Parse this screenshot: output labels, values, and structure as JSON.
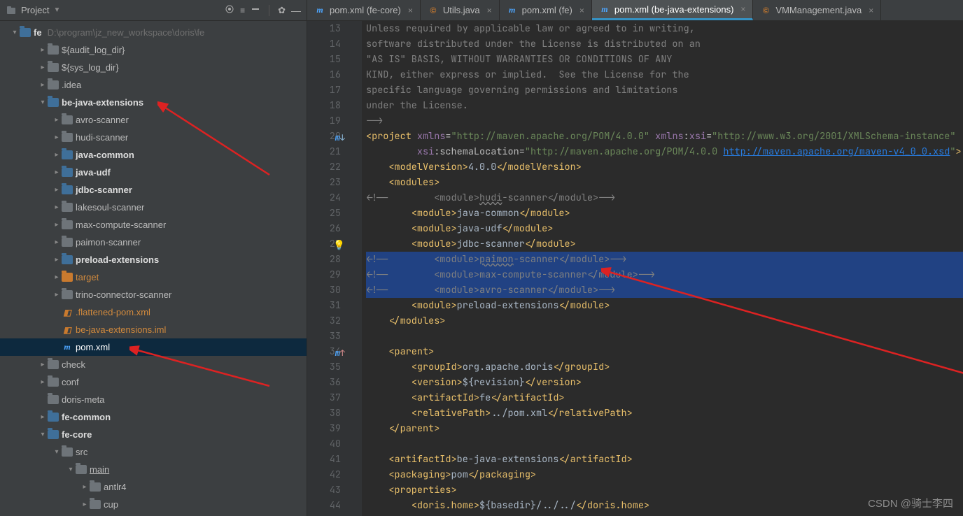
{
  "sidebar": {
    "title": "Project",
    "root": {
      "name": "fe",
      "path": "D:\\program\\jz_new_workspace\\doris\\fe"
    },
    "items": [
      {
        "name": "${audit_log_dir}",
        "indent": 2,
        "arrow": ">",
        "kind": "folder"
      },
      {
        "name": "${sys_log_dir}",
        "indent": 2,
        "arrow": ">",
        "kind": "folder"
      },
      {
        "name": ".idea",
        "indent": 2,
        "arrow": ">",
        "kind": "folder"
      },
      {
        "name": "be-java-extensions",
        "indent": 2,
        "arrow": "v",
        "kind": "mod",
        "bold": true
      },
      {
        "name": "avro-scanner",
        "indent": 3,
        "arrow": ">",
        "kind": "folder"
      },
      {
        "name": "hudi-scanner",
        "indent": 3,
        "arrow": ">",
        "kind": "folder"
      },
      {
        "name": "java-common",
        "indent": 3,
        "arrow": ">",
        "kind": "mod",
        "bold": true
      },
      {
        "name": "java-udf",
        "indent": 3,
        "arrow": ">",
        "kind": "mod",
        "bold": true
      },
      {
        "name": "jdbc-scanner",
        "indent": 3,
        "arrow": ">",
        "kind": "mod",
        "bold": true
      },
      {
        "name": "lakesoul-scanner",
        "indent": 3,
        "arrow": ">",
        "kind": "folder"
      },
      {
        "name": "max-compute-scanner",
        "indent": 3,
        "arrow": ">",
        "kind": "folder"
      },
      {
        "name": "paimon-scanner",
        "indent": 3,
        "arrow": ">",
        "kind": "folder"
      },
      {
        "name": "preload-extensions",
        "indent": 3,
        "arrow": ">",
        "kind": "mod",
        "bold": true
      },
      {
        "name": "target",
        "indent": 3,
        "arrow": ">",
        "kind": "orange",
        "highlight": true
      },
      {
        "name": "trino-connector-scanner",
        "indent": 3,
        "arrow": ">",
        "kind": "folder"
      },
      {
        "name": ".flattened-pom.xml",
        "indent": 3,
        "arrow": "",
        "kind": "file-xml",
        "highlight": true
      },
      {
        "name": "be-java-extensions.iml",
        "indent": 3,
        "arrow": "",
        "kind": "file-iml",
        "highlight": true
      },
      {
        "name": "pom.xml",
        "indent": 3,
        "arrow": "",
        "kind": "file-m",
        "selected": true
      },
      {
        "name": "check",
        "indent": 2,
        "arrow": ">",
        "kind": "folder"
      },
      {
        "name": "conf",
        "indent": 2,
        "arrow": ">",
        "kind": "folder"
      },
      {
        "name": "doris-meta",
        "indent": 2,
        "arrow": "",
        "kind": "folder"
      },
      {
        "name": "fe-common",
        "indent": 2,
        "arrow": ">",
        "kind": "mod",
        "bold": true
      },
      {
        "name": "fe-core",
        "indent": 2,
        "arrow": "v",
        "kind": "mod",
        "bold": true
      },
      {
        "name": "src",
        "indent": 3,
        "arrow": "v",
        "kind": "folder"
      },
      {
        "name": "main",
        "indent": 4,
        "arrow": "v",
        "kind": "folder",
        "underline": true
      },
      {
        "name": "antlr4",
        "indent": 5,
        "arrow": ">",
        "kind": "folder"
      },
      {
        "name": "cup",
        "indent": 5,
        "arrow": ">",
        "kind": "folder"
      }
    ]
  },
  "tabs": [
    {
      "icon": "m",
      "label": "pom.xml (fe-core)"
    },
    {
      "icon": "c",
      "label": "Utils.java"
    },
    {
      "icon": "m",
      "label": "pom.xml (fe)"
    },
    {
      "icon": "m",
      "label": "pom.xml (be-java-extensions)",
      "active": true
    },
    {
      "icon": "c",
      "label": "VMManagement.java"
    }
  ],
  "code": {
    "first_line": 13,
    "lines": [
      {
        "n": 13,
        "html": "<span class='c-comment'>Unless required by applicable law or agreed to in writing,</span>"
      },
      {
        "n": 14,
        "html": "<span class='c-comment'>software distributed under the License is distributed on an</span>"
      },
      {
        "n": 15,
        "html": "<span class='c-comment'>\"AS IS\" BASIS, WITHOUT WARRANTIES OR CONDITIONS OF ANY</span>"
      },
      {
        "n": 16,
        "html": "<span class='c-comment'>KIND, either express or implied.  See the License for the</span>"
      },
      {
        "n": 17,
        "html": "<span class='c-comment'>specific language governing permissions and limitations</span>"
      },
      {
        "n": 18,
        "html": "<span class='c-comment'>under the License.</span>"
      },
      {
        "n": 19,
        "html": "<span class='c-comment'>--&gt;</span>"
      },
      {
        "n": 20,
        "gut": "m↓",
        "html": "<span class='c-tag'>&lt;project</span> <span class='c-ns'>xmlns</span><span class='c-attr'>=</span><span class='c-str'>\"http://maven.apache.org/POM/4.0.0\"</span> <span class='c-ns'>xmlns</span><span class='c-attr'>:</span><span class='c-ns'>xsi</span><span class='c-attr'>=</span><span class='c-str'>\"http://www.w3.org/2001/XMLSchema-instance\"</span>"
      },
      {
        "n": 21,
        "html": "         <span class='c-ns'>xsi</span><span class='c-attr'>:</span><span class='c-attr'>schemaLocation</span><span class='c-attr'>=</span><span class='c-str'>\"http://maven.apache.org/POM/4.0.0 </span><span class='c-link'>http://maven.apache.org/maven-v4_0_0.xsd</span><span class='c-str'>\"</span><span class='c-tag'>&gt;</span>"
      },
      {
        "n": 22,
        "html": "    <span class='c-tag'>&lt;modelVersion&gt;</span><span class='c-text'>4.0.0</span><span class='c-tag'>&lt;/modelVersion&gt;</span>"
      },
      {
        "n": 23,
        "html": "    <span class='c-tag'>&lt;modules&gt;</span>"
      },
      {
        "n": 24,
        "html": "<span class='c-comment'>&lt;!--        &lt;module&gt;<span class='c-underline'>hudi</span>-scanner&lt;/module&gt;--&gt;</span>"
      },
      {
        "n": 25,
        "html": "        <span class='c-tag'>&lt;module&gt;</span><span class='c-text'>java-common</span><span class='c-tag'>&lt;/module&gt;</span>"
      },
      {
        "n": 26,
        "html": "        <span class='c-tag'>&lt;module&gt;</span><span class='c-text'>java-udf</span><span class='c-tag'>&lt;/module&gt;</span>"
      },
      {
        "n": 27,
        "gut": "bulb",
        "html": "        <span class='c-tag'>&lt;module&gt;</span><span class='c-text'>jdbc-scanner</span><span class='c-tag'>&lt;/module&gt;</span>"
      },
      {
        "n": 28,
        "sel": true,
        "html": "<span class='c-comment'>&lt;!--        &lt;module&gt;<span class='c-underline'>paimon</span>-scanner&lt;/module&gt;--&gt;</span>"
      },
      {
        "n": 29,
        "sel": true,
        "html": "<span class='c-comment'>&lt;!--        &lt;module&gt;max-compute-scanner&lt;/module&gt;--&gt;</span>"
      },
      {
        "n": 30,
        "sel": true,
        "html": "<span class='c-comment'>&lt;!--        &lt;module&gt;avro-scanner&lt;/module&gt;--&gt;</span>"
      },
      {
        "n": 31,
        "html": "        <span class='c-tag'>&lt;module&gt;</span><span class='c-text'>preload-extensions</span><span class='c-tag'>&lt;/module&gt;</span>"
      },
      {
        "n": 32,
        "html": "    <span class='c-tag'>&lt;/modules&gt;</span>"
      },
      {
        "n": 33,
        "html": ""
      },
      {
        "n": 34,
        "gut": "m↑",
        "html": "    <span class='c-tag'>&lt;parent&gt;</span>"
      },
      {
        "n": 35,
        "html": "        <span class='c-tag'>&lt;groupId&gt;</span><span class='c-text'>org.apache.doris</span><span class='c-tag'>&lt;/groupId&gt;</span>"
      },
      {
        "n": 36,
        "html": "        <span class='c-tag'>&lt;version&gt;</span><span class='c-text'>${revision}</span><span class='c-tag'>&lt;/version&gt;</span>"
      },
      {
        "n": 37,
        "html": "        <span class='c-tag'>&lt;artifactId&gt;</span><span class='c-text'>fe</span><span class='c-tag'>&lt;/artifactId&gt;</span>"
      },
      {
        "n": 38,
        "html": "        <span class='c-tag'>&lt;relativePath&gt;</span><span class='c-text'>../pom.xml</span><span class='c-tag'>&lt;/relativePath&gt;</span>"
      },
      {
        "n": 39,
        "html": "    <span class='c-tag'>&lt;/parent&gt;</span>"
      },
      {
        "n": 40,
        "html": ""
      },
      {
        "n": 41,
        "html": "    <span class='c-tag'>&lt;artifactId&gt;</span><span class='c-text'>be-java-extensions</span><span class='c-tag'>&lt;/artifactId&gt;</span>"
      },
      {
        "n": 42,
        "html": "    <span class='c-tag'>&lt;packaging&gt;</span><span class='c-text'>pom</span><span class='c-tag'>&lt;/packaging&gt;</span>"
      },
      {
        "n": 43,
        "html": "    <span class='c-tag'>&lt;properties&gt;</span>"
      },
      {
        "n": 44,
        "html": "        <span class='c-tag'>&lt;doris.home&gt;</span><span class='c-text'>${basedir}/../../</span><span class='c-tag'>&lt;/doris.home&gt;</span>"
      }
    ]
  },
  "watermark": "CSDN @骑士李四"
}
